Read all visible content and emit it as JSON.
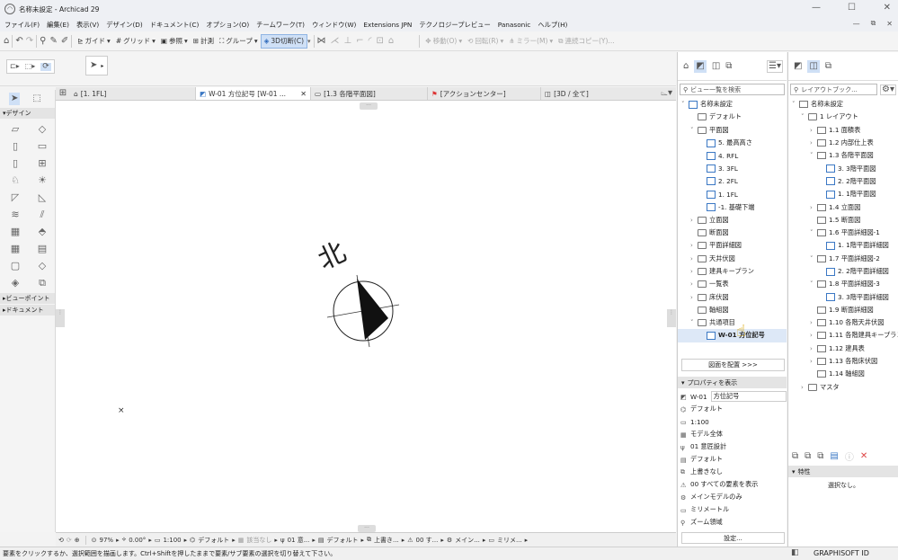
{
  "window": {
    "title": "名称未設定 - Archicad 29"
  },
  "menu": [
    "ファイル(F)",
    "編集(E)",
    "表示(V)",
    "デザイン(D)",
    "ドキュメント(C)",
    "オプション(O)",
    "チームワーク(T)",
    "ウィンドウ(W)",
    "Extensions JPN",
    "テクノロジープレビュー",
    "Panasonic",
    "ヘルプ(H)"
  ],
  "toolbar": {
    "guide": "ガイド",
    "grid": "グリッド",
    "ref": "参照",
    "measure": "計測",
    "group": "グループ",
    "section3d": "3D切断(C)",
    "move": "移動(O)",
    "rotate": "回転(R)",
    "mirror": "ミラー(M)",
    "multicopy": "連続コピー(Y)..."
  },
  "toolbox": {
    "design": "デザイン",
    "viewpoint": "ビューポイント",
    "document": "ドキュメント"
  },
  "tabs": [
    {
      "label": "[1. 1FL]"
    },
    {
      "label": "W-01 方位記号 [W-01 ..."
    },
    {
      "label": "[1.3 各階平面図]"
    },
    {
      "label": "[アクションセンター]"
    },
    {
      "label": "[3D / 全て]"
    }
  ],
  "canvas": {
    "north_label": "北",
    "marker": "×"
  },
  "bottombar": {
    "zoom": "97%",
    "angle": "0.00°",
    "scale": "1:100",
    "layer": "デフォルト",
    "override": "該当なし",
    "renov": "01 意...",
    "dim": "デフォルト",
    "overwrite": "上書き...",
    "show": "00 す...",
    "model": "メイン...",
    "unit": "ミリメ..."
  },
  "status": {
    "hint": "要素をクリックするか、選択範囲を描画します。Ctrl+Shiftを押したままで要素/サブ要素の選択を切り替えて下さい。",
    "brand": "GRAPHISOFT ID"
  },
  "navigator": {
    "search": "ビュー一覧を検索",
    "items": [
      {
        "label": "名称未設定",
        "indent": 0,
        "arrow": "˅",
        "icon": "plan"
      },
      {
        "label": "デフォルト",
        "indent": 1,
        "arrow": "",
        "icon": "fold"
      },
      {
        "label": "平面図",
        "indent": 1,
        "arrow": "˅",
        "icon": "fold"
      },
      {
        "label": "5. 最高高さ",
        "indent": 2,
        "arrow": "",
        "icon": "plan"
      },
      {
        "label": "4. RFL",
        "indent": 2,
        "arrow": "",
        "icon": "plan"
      },
      {
        "label": "3. 3FL",
        "indent": 2,
        "arrow": "",
        "icon": "plan"
      },
      {
        "label": "2. 2FL",
        "indent": 2,
        "arrow": "",
        "icon": "plan"
      },
      {
        "label": "1. 1FL",
        "indent": 2,
        "arrow": "",
        "icon": "plan"
      },
      {
        "label": "-1. 基礎下端",
        "indent": 2,
        "arrow": "",
        "icon": "plan"
      },
      {
        "label": "立面図",
        "indent": 1,
        "arrow": "›",
        "icon": "fold"
      },
      {
        "label": "断面図",
        "indent": 1,
        "arrow": "",
        "icon": "fold"
      },
      {
        "label": "平面詳細図",
        "indent": 1,
        "arrow": "›",
        "icon": "fold"
      },
      {
        "label": "天井伏図",
        "indent": 1,
        "arrow": "›",
        "icon": "fold"
      },
      {
        "label": "建具キープラン",
        "indent": 1,
        "arrow": "›",
        "icon": "fold"
      },
      {
        "label": "一覧表",
        "indent": 1,
        "arrow": "›",
        "icon": "fold"
      },
      {
        "label": "床伏図",
        "indent": 1,
        "arrow": "›",
        "icon": "fold"
      },
      {
        "label": "軸組図",
        "indent": 1,
        "arrow": "",
        "icon": "fold"
      },
      {
        "label": "共通項目",
        "indent": 1,
        "arrow": "˅",
        "icon": "fold"
      },
      {
        "label": "W-01 方位記号",
        "indent": 2,
        "arrow": "",
        "icon": "plan",
        "selected": true
      }
    ],
    "place_btn": "図面を配置 >>>",
    "props_header": "プロパティを表示",
    "props": [
      {
        "label": "W-01",
        "value": "方位記号"
      },
      {
        "label": "デフォルト"
      },
      {
        "label": "1:100"
      },
      {
        "label": "モデル全体"
      },
      {
        "label": "01 意匠設計"
      },
      {
        "label": "デフォルト"
      },
      {
        "label": "上書きなし"
      },
      {
        "label": "00 すべての要素を表示"
      },
      {
        "label": "メインモデルのみ"
      },
      {
        "label": "ミリメートル"
      },
      {
        "label": "ズーム領域"
      }
    ],
    "settings_btn": "設定..."
  },
  "layout_book": {
    "search": "レイアウトブック...",
    "items": [
      {
        "label": "名称未設定",
        "indent": 0,
        "arrow": "˅",
        "icon": "sheet"
      },
      {
        "label": "1 レイアウト",
        "indent": 1,
        "arrow": "˅",
        "icon": "fold"
      },
      {
        "label": "1.1 面積表",
        "indent": 2,
        "arrow": "›",
        "icon": "sheet"
      },
      {
        "label": "1.2 内部仕上表",
        "indent": 2,
        "arrow": "›",
        "icon": "sheet"
      },
      {
        "label": "1.3 各階平面図",
        "indent": 2,
        "arrow": "˅",
        "icon": "sheet"
      },
      {
        "label": "3. 3階平面図",
        "indent": 3,
        "arrow": "",
        "icon": "plan"
      },
      {
        "label": "2. 2階平面図",
        "indent": 3,
        "arrow": "",
        "icon": "plan"
      },
      {
        "label": "1. 1階平面図",
        "indent": 3,
        "arrow": "",
        "icon": "plan"
      },
      {
        "label": "1.4 立面図",
        "indent": 2,
        "arrow": "›",
        "icon": "sheet"
      },
      {
        "label": "1.5 断面図",
        "indent": 2,
        "arrow": "",
        "icon": "sheet"
      },
      {
        "label": "1.6 平面詳細図-1",
        "indent": 2,
        "arrow": "˅",
        "icon": "sheet"
      },
      {
        "label": "1. 1階平面詳細図",
        "indent": 3,
        "arrow": "",
        "icon": "plan"
      },
      {
        "label": "1.7 平面詳細図-2",
        "indent": 2,
        "arrow": "˅",
        "icon": "sheet"
      },
      {
        "label": "2. 2階平面詳細図",
        "indent": 3,
        "arrow": "",
        "icon": "plan"
      },
      {
        "label": "1.8 平面詳細図-3",
        "indent": 2,
        "arrow": "˅",
        "icon": "sheet"
      },
      {
        "label": "3. 3階平面詳細図",
        "indent": 3,
        "arrow": "",
        "icon": "plan"
      },
      {
        "label": "1.9 断面詳細図",
        "indent": 2,
        "arrow": "",
        "icon": "sheet"
      },
      {
        "label": "1.10 各階天井伏図",
        "indent": 2,
        "arrow": "›",
        "icon": "sheet"
      },
      {
        "label": "1.11 各階建具キープラン",
        "indent": 2,
        "arrow": "›",
        "icon": "sheet"
      },
      {
        "label": "1.12 建具表",
        "indent": 2,
        "arrow": "›",
        "icon": "sheet"
      },
      {
        "label": "1.13 各階床伏図",
        "indent": 2,
        "arrow": "›",
        "icon": "sheet"
      },
      {
        "label": "1.14 軸組図",
        "indent": 2,
        "arrow": "",
        "icon": "sheet"
      },
      {
        "label": "マスタ",
        "indent": 1,
        "arrow": "›",
        "icon": "fold"
      }
    ],
    "attr_header": "特性",
    "attr_value": "選択なし。"
  }
}
